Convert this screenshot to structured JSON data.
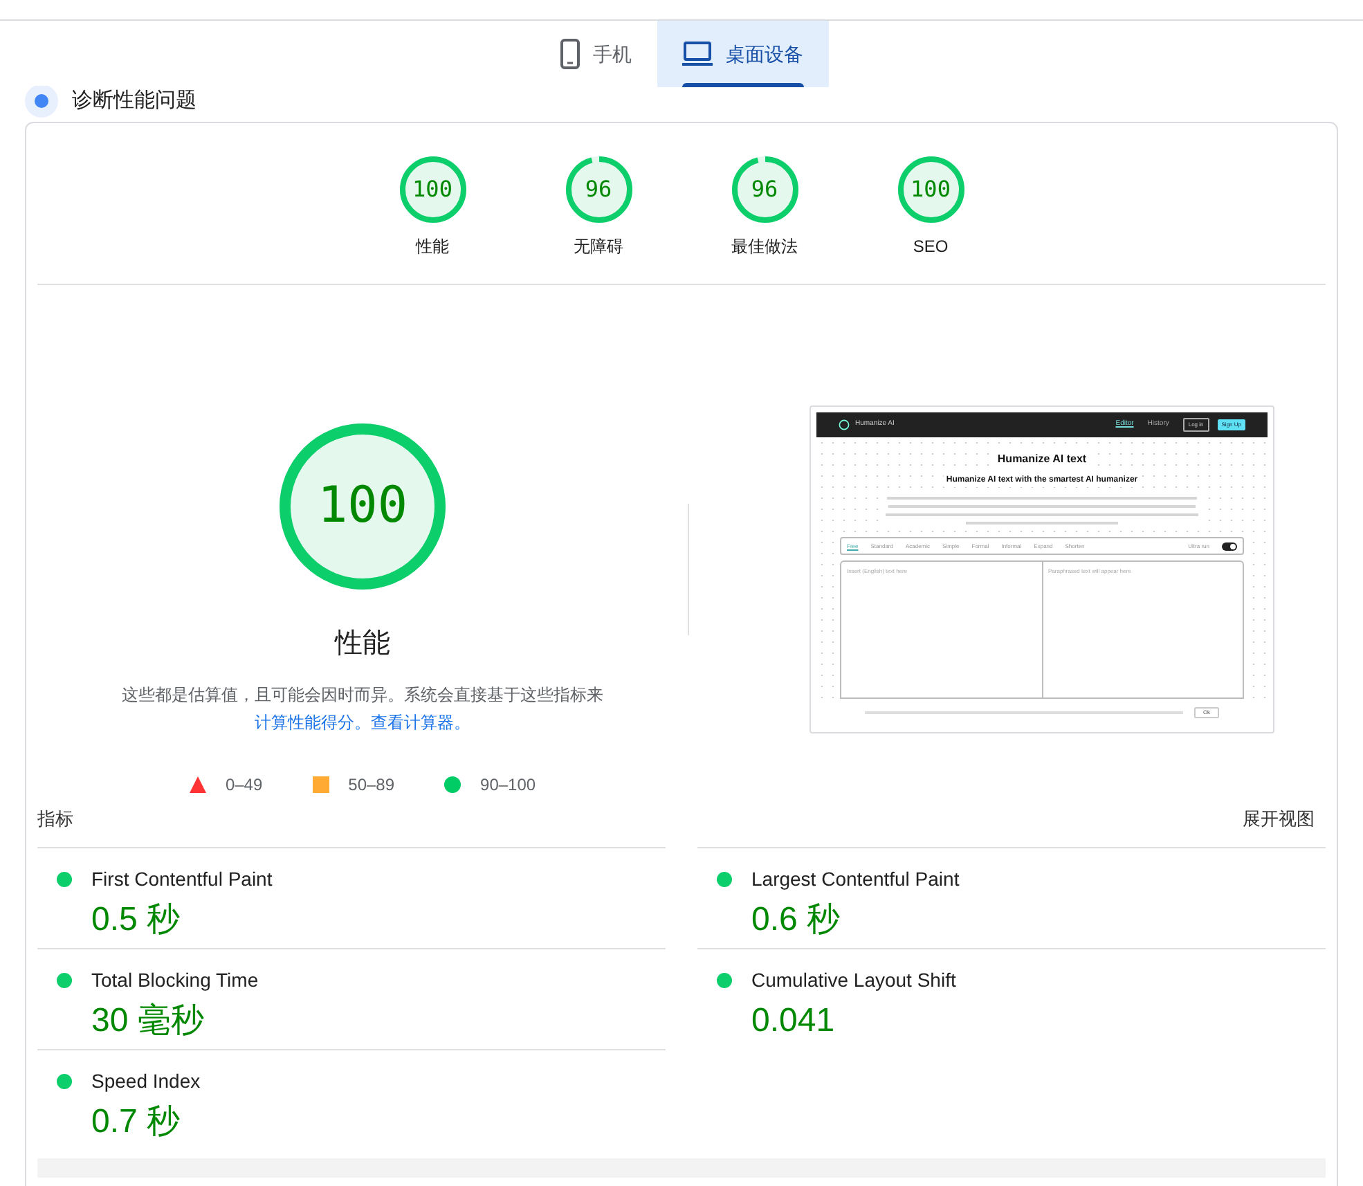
{
  "tabs": [
    {
      "label": "手机",
      "kind": "phone",
      "selected": false
    },
    {
      "label": "桌面设备",
      "kind": "desktop",
      "selected": true
    }
  ],
  "section_heading": "诊断性能问题",
  "category_scores": [
    {
      "score": "100",
      "label": "性能"
    },
    {
      "score": "96",
      "label": "无障碍"
    },
    {
      "score": "96",
      "label": "最佳做法"
    },
    {
      "score": "100",
      "label": "SEO"
    }
  ],
  "performance": {
    "score": "100",
    "title": "性能",
    "note": "这些都是估算值，且可能会因时而异。系统会直接基于这些指标来",
    "links": [
      "计算性能得分。",
      "查看计算器。"
    ]
  },
  "legend": [
    {
      "kind": "triangle",
      "color": "#ff3333",
      "label": "0–49"
    },
    {
      "kind": "square",
      "color": "#ffaa33",
      "label": "50–89"
    },
    {
      "kind": "circle",
      "color": "#00cc66",
      "label": "90–100"
    }
  ],
  "thumbnail": {
    "brand": "Humanize AI",
    "nav": [
      {
        "label": "Editor",
        "selected": true
      },
      {
        "label": "History",
        "selected": false
      }
    ],
    "login": "Log in",
    "signup": "Sign Up",
    "title": "Humanize AI text",
    "subtitle": "Humanize AI text with the smartest AI humanizer",
    "modes": [
      {
        "label": "Free",
        "selected": true
      },
      {
        "label": "Standard",
        "selected": false
      },
      {
        "label": "Academic",
        "selected": false
      },
      {
        "label": "Simple",
        "selected": false
      },
      {
        "label": "Formal",
        "selected": false
      },
      {
        "label": "Informal",
        "selected": false
      },
      {
        "label": "Expand",
        "selected": false
      },
      {
        "label": "Shorten",
        "selected": false
      }
    ],
    "toggle_label": "Ultra run",
    "toggle_on": true,
    "input_placeholder": "Insert (English) text here",
    "output_placeholder": "Paraphrased text will appear here",
    "cookie_button": "Ok"
  },
  "metrics_heading": "指标",
  "expand_link": "展开视图",
  "metrics": [
    {
      "name": "First Contentful Paint",
      "value": "0.5 秒"
    },
    {
      "name": "Largest Contentful Paint",
      "value": "0.6 秒"
    },
    {
      "name": "Total Blocking Time",
      "value": "30 毫秒"
    },
    {
      "name": "Cumulative Layout Shift",
      "value": "0.041"
    },
    {
      "name": "Speed Index",
      "value": "0.7 秒"
    }
  ]
}
